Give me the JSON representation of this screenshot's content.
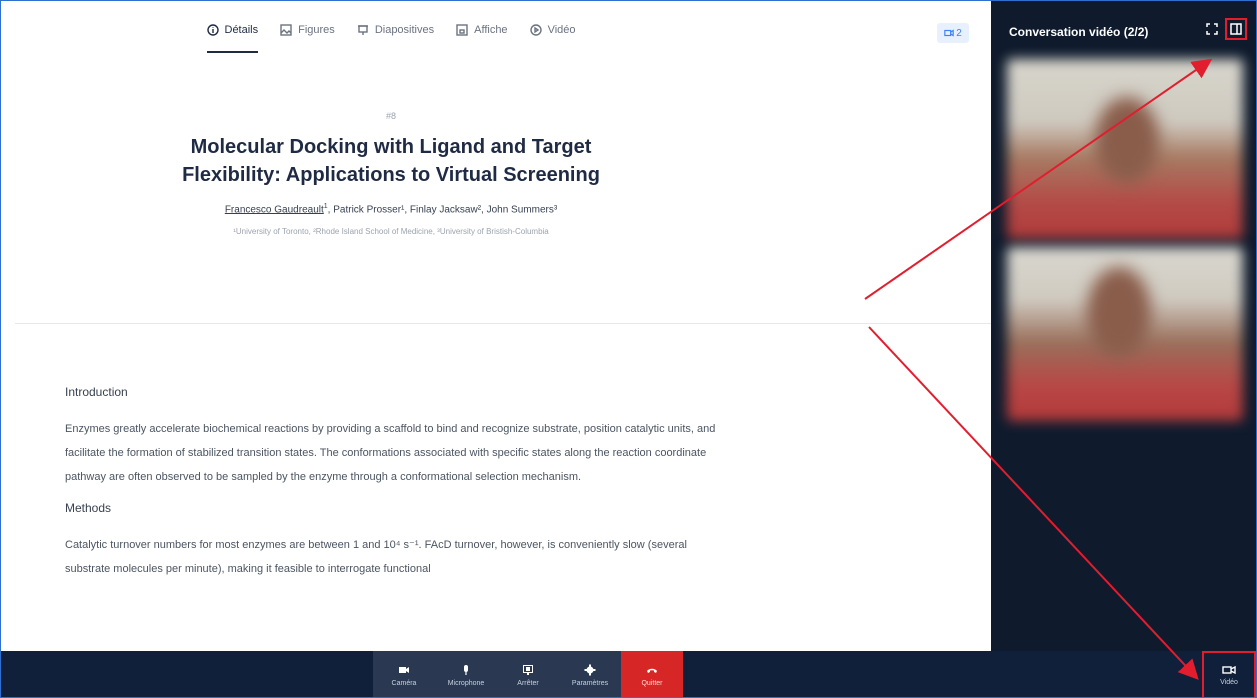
{
  "tabs": [
    {
      "label": "Détails",
      "icon": "info-icon"
    },
    {
      "label": "Figures",
      "icon": "image-icon"
    },
    {
      "label": "Diapositives",
      "icon": "presentation-icon"
    },
    {
      "label": "Affiche",
      "icon": "poster-icon"
    },
    {
      "label": "Vidéo",
      "icon": "play-icon"
    }
  ],
  "video_count": "2",
  "poster": {
    "number": "#8",
    "title_line1": "Molecular Docking with Ligand and Target",
    "title_line2": "Flexibility: Applications to Virtual Screening",
    "author1": "Francesco Gaudreault",
    "author1_sup": "1",
    "author_rest": ", Patrick Prosser¹, Finlay Jacksaw², John Summers³",
    "affiliations": "¹University of Toronto, ²Rhode Island School of Medicine, ³University of Bristish-Columbia"
  },
  "sections": {
    "intro_heading": "Introduction",
    "intro_text": "Enzymes greatly accelerate biochemical reactions by providing a scaffold to bind and recognize substrate, position catalytic units, and facilitate the formation of stabilized transition states. The conformations associated with specific states along the reaction coordinate pathway are often observed to be sampled by the enzyme through a conformational selection mechanism.",
    "methods_heading": "Methods",
    "methods_text": "Catalytic turnover numbers for most enzymes are between 1 and 10⁴ s⁻¹. FAcD turnover, however, is conveniently slow (several substrate molecules per minute), making it feasible to interrogate functional"
  },
  "sidebar": {
    "title": "Conversation vidéo (2/2)"
  },
  "controls": [
    {
      "label": "Caméra",
      "icon": "camera-icon"
    },
    {
      "label": "Microphone",
      "icon": "microphone-icon"
    },
    {
      "label": "Arrêter",
      "icon": "stop-share-icon"
    },
    {
      "label": "Paramètres",
      "icon": "gear-icon"
    },
    {
      "label": "Quitter",
      "icon": "hangup-icon"
    }
  ],
  "video_button": {
    "label": "Vidéo",
    "icon": "video-icon"
  },
  "colors": {
    "accent": "#1f2a44",
    "sidebar": "#0f1b2d",
    "bar": "#10203a",
    "quit": "#d72626",
    "highlight": "#e11d2e"
  }
}
